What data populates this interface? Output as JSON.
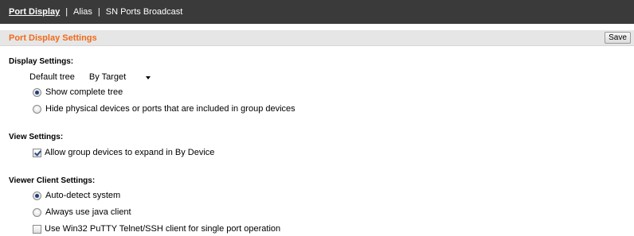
{
  "nav": {
    "items": [
      {
        "label": "Port Display",
        "active": true
      },
      {
        "label": "Alias",
        "active": false
      },
      {
        "label": "SN Ports Broadcast",
        "active": false
      }
    ],
    "separator": "|"
  },
  "section": {
    "title": "Port Display Settings",
    "save_label": "Save"
  },
  "display_settings": {
    "heading": "Display Settings:",
    "default_tree_label": "Default tree",
    "default_tree_value": "By Target",
    "options": [
      {
        "label": "Show complete tree",
        "checked": true
      },
      {
        "label": "Hide physical devices or ports that are included in group devices",
        "checked": false
      }
    ]
  },
  "view_settings": {
    "heading": "View Settings:",
    "expand_label": "Allow group devices to expand in By Device",
    "expand_checked": true
  },
  "viewer_client_settings": {
    "heading": "Viewer Client Settings:",
    "options": [
      {
        "label": "Auto-detect system",
        "checked": true
      },
      {
        "label": "Always use java client",
        "checked": false
      }
    ],
    "putty_label": "Use Win32 PuTTY Telnet/SSH client for single port operation",
    "putty_checked": false
  },
  "colors": {
    "nav_bg": "#3a3a3a",
    "section_bg": "#e6e6e6",
    "section_title": "#f06a1a"
  }
}
